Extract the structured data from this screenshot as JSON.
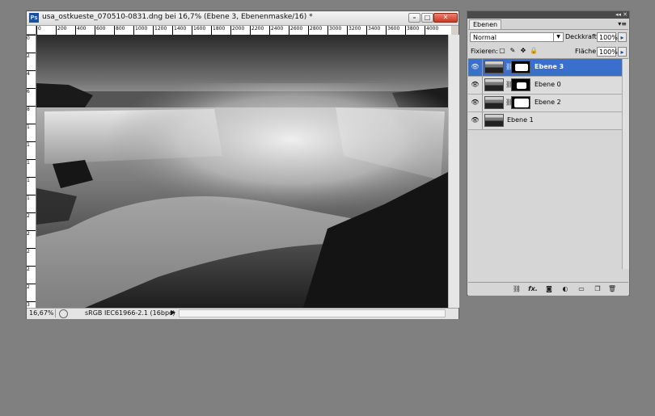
{
  "document": {
    "title": "usa_ostkueste_070510-0831.dng bei 16,7% (Ebene 3, Ebenenmaske/16) *",
    "app_icon": "Ps",
    "window_buttons": {
      "minimize": "–",
      "maximize": "□",
      "close": "✕"
    },
    "ruler_top": [
      "0",
      "200",
      "400",
      "600",
      "800",
      "1000",
      "1200",
      "1400",
      "1600",
      "1800",
      "2000",
      "2200",
      "2400",
      "2600",
      "2800",
      "3000",
      "3200",
      "3400",
      "3600",
      "3800",
      "4000"
    ],
    "ruler_left": [
      "0",
      "2",
      "4",
      "6",
      "8",
      "1",
      "1",
      "1",
      "1",
      "1",
      "2",
      "2",
      "2",
      "2",
      "2",
      "3"
    ],
    "status": {
      "zoom": "16,67%",
      "profile": "sRGB IEC61966-2.1 (16bpc)",
      "arrow": "▶"
    }
  },
  "layers_panel": {
    "tab": "Ebenen",
    "collapse": "◂◂",
    "close": "✕",
    "menu": "▾≡",
    "blend_mode": "Normal",
    "opacity_label": "Deckkraft:",
    "opacity_value": "100%",
    "lock_label": "Fixieren:",
    "fill_label": "Fläche:",
    "fill_value": "100%",
    "stepper_arrow": "▸",
    "layers": [
      {
        "name": "Ebene 3",
        "selected": true,
        "has_mask": true
      },
      {
        "name": "Ebene 0",
        "selected": false,
        "has_mask": true
      },
      {
        "name": "Ebene 2",
        "selected": false,
        "has_mask": true
      },
      {
        "name": "Ebene 1",
        "selected": false,
        "has_mask": false
      }
    ],
    "footer_icons": [
      "link-layers-icon",
      "fx-icon",
      "add-mask-icon",
      "adjustment-layer-icon",
      "new-group-icon",
      "new-layer-icon",
      "trash-icon"
    ],
    "footer_glyphs": {
      "link": "⛓",
      "fx": "fx.",
      "mask": "◙",
      "adjust": "◐",
      "group": "▭",
      "new": "❐",
      "trash": "🗑"
    }
  },
  "colors": {
    "selected_layer": "#3a6fcb",
    "workspace": "#808080"
  }
}
